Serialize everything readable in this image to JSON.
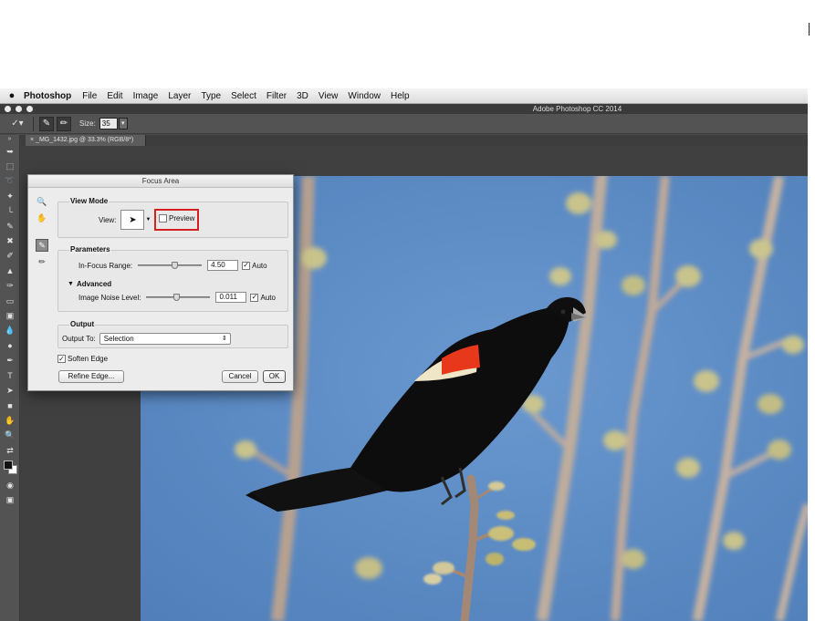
{
  "menubar": {
    "apple_icon": "apple-icon",
    "app_name": "Photoshop",
    "items": [
      "File",
      "Edit",
      "Image",
      "Layer",
      "Type",
      "Select",
      "Filter",
      "3D",
      "View",
      "Window",
      "Help"
    ]
  },
  "window": {
    "title": "Adobe Photoshop CC 2014"
  },
  "options_bar": {
    "size_label": "Size:",
    "size_value": "35"
  },
  "document_tab": {
    "label": "_MG_1432.jpg @ 33.3% (RGB/8*)"
  },
  "dialog": {
    "title": "Focus Area",
    "view_mode": {
      "title": "View Mode",
      "view_label": "View:",
      "preview_label": "Preview",
      "preview_checked": false
    },
    "parameters": {
      "title": "Parameters",
      "in_focus_label": "In-Focus Range:",
      "in_focus_value": "4.50",
      "in_focus_auto_label": "Auto",
      "in_focus_auto_checked": true,
      "in_focus_slider_level": 0.58,
      "advanced_label": "Advanced",
      "noise_label": "Image Noise Level:",
      "noise_value": "0.011",
      "noise_auto_label": "Auto",
      "noise_auto_checked": true,
      "noise_slider_level": 0.47
    },
    "output": {
      "title": "Output",
      "output_to_label": "Output To:",
      "output_to_value": "Selection"
    },
    "soften_edge_label": "Soften Edge",
    "soften_edge_checked": true,
    "refine_edge_label": "Refine Edge...",
    "cancel_label": "Cancel",
    "ok_label": "OK"
  },
  "colors": {
    "sky": "#5e8cc4",
    "bird": "#0d0d0d",
    "epaulet_red": "#e8381c",
    "epaulet_cream": "#efe6c8",
    "highlight_red": "#d52020"
  }
}
